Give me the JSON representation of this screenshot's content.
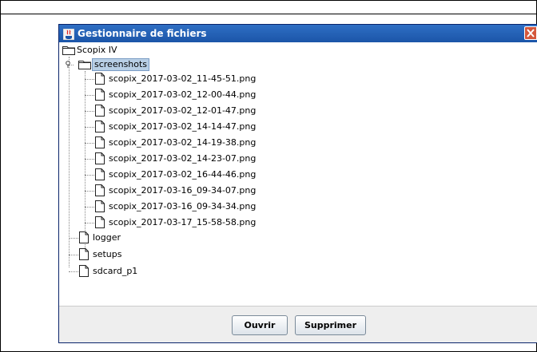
{
  "window": {
    "title": "Gestionnaire de fichiers"
  },
  "tree": {
    "root": "Scopix IV",
    "folder": "screenshots",
    "files": [
      "scopix_2017-03-02_11-45-51.png",
      "scopix_2017-03-02_12-00-44.png",
      "scopix_2017-03-02_12-01-47.png",
      "scopix_2017-03-02_14-14-47.png",
      "scopix_2017-03-02_14-19-38.png",
      "scopix_2017-03-02_14-23-07.png",
      "scopix_2017-03-02_16-44-46.png",
      "scopix_2017-03-16_09-34-07.png",
      "scopix_2017-03-16_09-34-34.png",
      "scopix_2017-03-17_15-58-58.png"
    ],
    "root_items": [
      "logger",
      "setups",
      "sdcard_p1"
    ]
  },
  "buttons": {
    "open": "Ouvrir",
    "delete": "Supprimer"
  },
  "colors": {
    "titlebar": "#1b55a8",
    "close": "#d4573b",
    "selection": "#b8cfe5"
  }
}
